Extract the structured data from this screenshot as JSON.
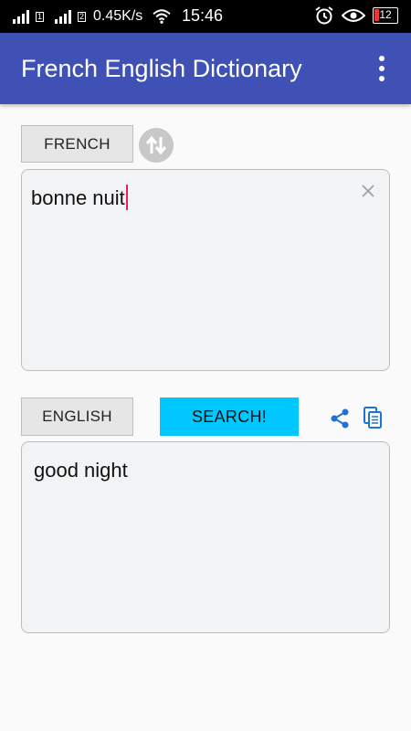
{
  "status_bar": {
    "sim1": "1",
    "sim2": "2",
    "speed": "0.45K/s",
    "time": "15:46",
    "battery": "12"
  },
  "app_bar": {
    "title": "French English Dictionary",
    "color": "#3f51b5"
  },
  "source": {
    "language": "FRENCH",
    "text": "bonne nuit"
  },
  "target": {
    "language": "ENGLISH",
    "text": "good night"
  },
  "actions": {
    "search_label": "SEARCH!",
    "search_color": "#00c8ff",
    "icons": [
      "swap-icon",
      "clear-icon",
      "share-icon",
      "copy-icon",
      "overflow-menu-icon"
    ]
  }
}
